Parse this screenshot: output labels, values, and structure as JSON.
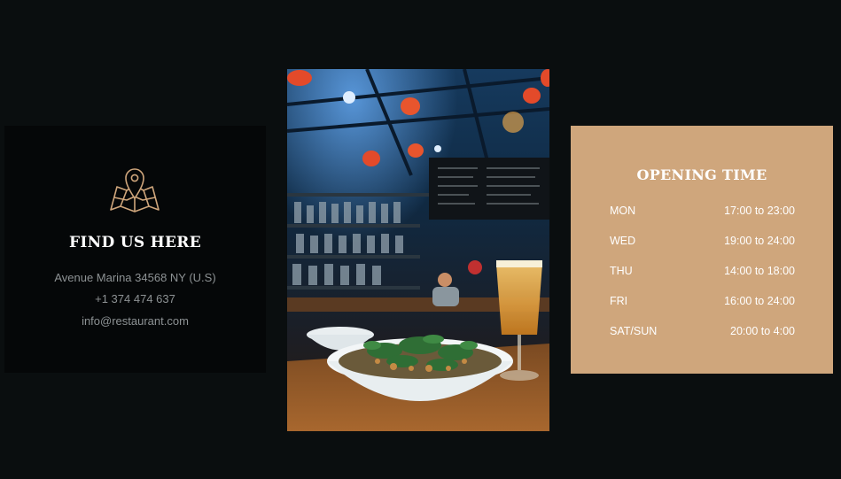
{
  "contact": {
    "title": "FIND US HERE",
    "address": "Avenue Marina 34568 NY (U.S)",
    "phone": "+1 374 474 637",
    "email": "info@restaurant.com",
    "icon": "map-pin-icon",
    "accent": "#cfa67c"
  },
  "photo": {
    "description_icon": "restaurant-photo"
  },
  "hours": {
    "title": "OPENING TIME",
    "background": "#cfa67c",
    "rows": [
      {
        "day": "MON",
        "time": "17:00 to 23:00"
      },
      {
        "day": "WED",
        "time": "19:00 to 24:00"
      },
      {
        "day": "THU",
        "time": "14:00 to 18:00"
      },
      {
        "day": "FRI",
        "time": "16:00 to 24:00"
      },
      {
        "day": "SAT/SUN",
        "time": "20:00 to 4:00"
      }
    ]
  }
}
